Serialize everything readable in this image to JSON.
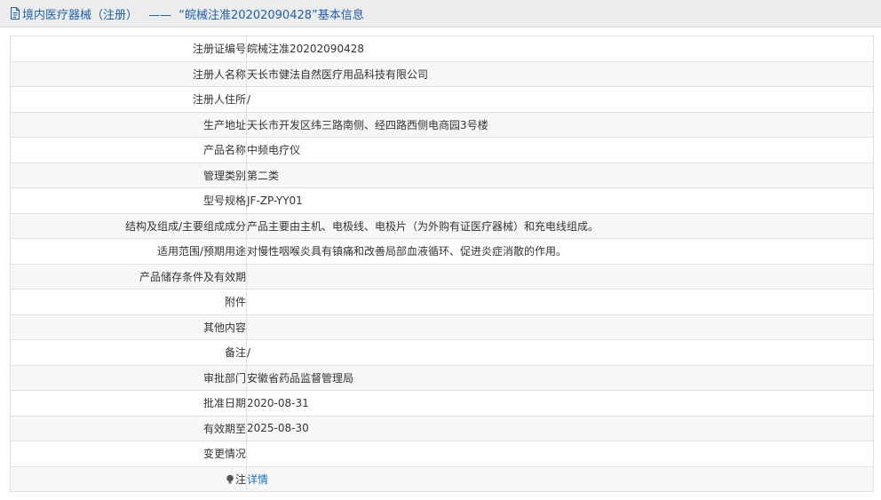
{
  "header": {
    "category": "境内医疗器械（注册）",
    "separator": "——",
    "record_title": "“皖械注准20202090428”基本信息"
  },
  "rows": [
    {
      "label": "注册证编号",
      "value": "皖械注准20202090428"
    },
    {
      "label": "注册人名称",
      "value": "天长市健法自然医疗用品科技有限公司"
    },
    {
      "label": "注册人住所",
      "value": "/"
    },
    {
      "label": "生产地址",
      "value": "天长市开发区纬三路南侧、经四路西侧电商园3号楼"
    },
    {
      "label": "产品名称",
      "value": "中频电疗仪"
    },
    {
      "label": "管理类别",
      "value": "第二类"
    },
    {
      "label": "型号规格",
      "value": "JF-ZP-YY01"
    },
    {
      "label": "结构及组成/主要组成成分",
      "value": "产品主要由主机、电极线、电极片（为外购有证医疗器械）和充电线组成。"
    },
    {
      "label": "适用范围/预期用途",
      "value": "对慢性咽喉炎具有镇痛和改善局部血液循环、促进炎症消散的作用。"
    },
    {
      "label": "产品储存条件及有效期",
      "value": ""
    },
    {
      "label": "附件",
      "value": ""
    },
    {
      "label": "其他内容",
      "value": ""
    },
    {
      "label": "备注",
      "value": "/"
    },
    {
      "label": "审批部门",
      "value": "安徽省药品监督管理局"
    },
    {
      "label": "批准日期",
      "value": "2020-08-31"
    },
    {
      "label": "有效期至",
      "value": "2025-08-30"
    },
    {
      "label": "变更情况",
      "value": ""
    }
  ],
  "note_row": {
    "icon": "lightbulb-icon",
    "label": "注",
    "link_text": "详情"
  },
  "colors": {
    "header_text": "#1f5ea8",
    "link": "#1f6fb8"
  }
}
